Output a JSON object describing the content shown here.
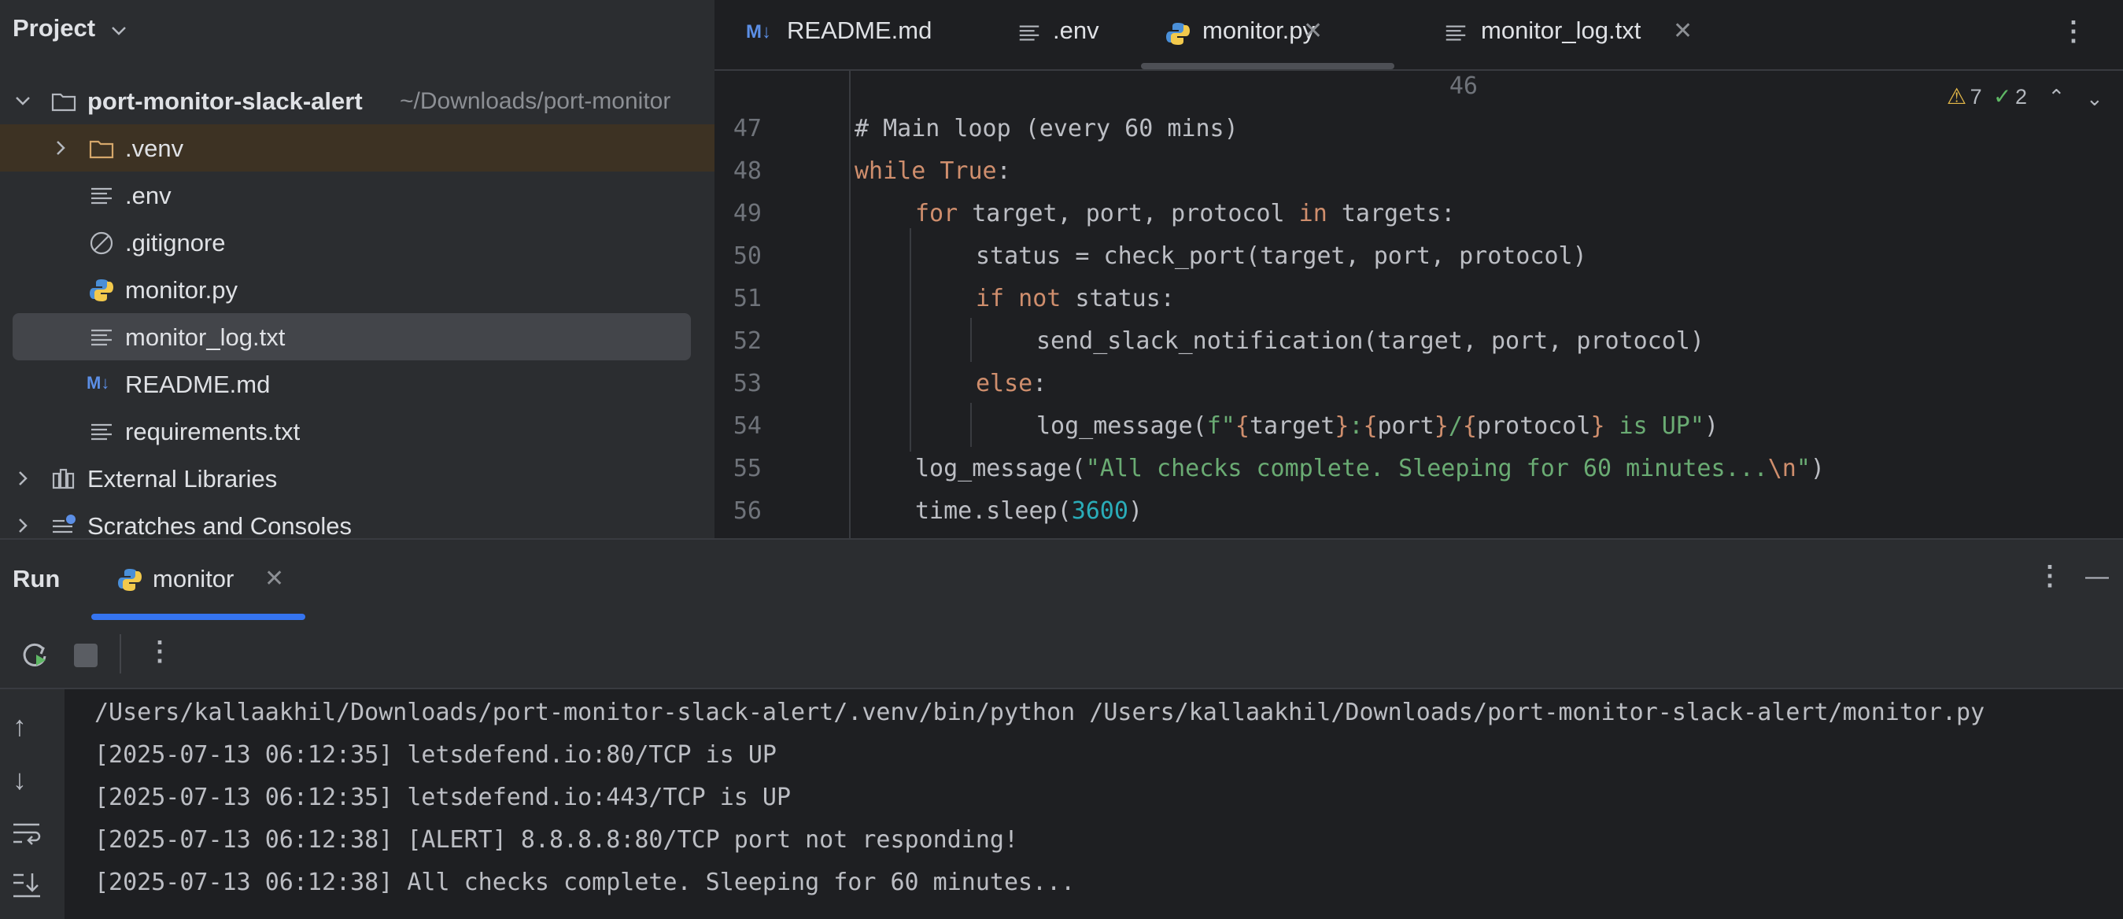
{
  "project": {
    "title": "Project",
    "tree": [
      {
        "label": "port-monitor-slack-alert",
        "path": "~/Downloads/port-monitor",
        "icon": "folder-icon"
      },
      {
        "label": ".venv",
        "icon": "folder-icon"
      },
      {
        "label": ".env",
        "icon": "text-file-icon"
      },
      {
        "label": ".gitignore",
        "icon": "ignore-file-icon"
      },
      {
        "label": "monitor.py",
        "icon": "python-icon"
      },
      {
        "label": "monitor_log.txt",
        "icon": "text-file-icon"
      },
      {
        "label": "README.md",
        "icon": "markdown-icon"
      },
      {
        "label": "requirements.txt",
        "icon": "text-file-icon"
      },
      {
        "label": "External Libraries",
        "icon": "library-icon"
      },
      {
        "label": "Scratches and Consoles",
        "icon": "scratches-icon"
      }
    ]
  },
  "editor": {
    "tabs": [
      {
        "label": "README.md",
        "icon": "markdown-icon"
      },
      {
        "label": ".env",
        "icon": "text-file-icon"
      },
      {
        "label": "monitor.py",
        "icon": "python-icon",
        "active": true
      },
      {
        "label": "monitor_log.txt",
        "icon": "text-file-icon"
      }
    ],
    "inspections": {
      "warnings": "7",
      "checks": "2"
    },
    "lines": [
      {
        "n": "46"
      },
      {
        "n": "47",
        "text": "# Main loop (every 60 mins)"
      },
      {
        "n": "48",
        "kw": "while",
        "rest_kw": "True",
        "rest": ":"
      },
      {
        "n": "49",
        "kw": "for",
        "a": "target, port, protocol",
        "kw2": "in",
        "b": "targets:"
      },
      {
        "n": "50",
        "text": "status = check_port(target, port, protocol)"
      },
      {
        "n": "51",
        "kw": "if not",
        "rest": "status:"
      },
      {
        "n": "52",
        "text": "send_slack_notification(target, port, protocol)"
      },
      {
        "n": "53",
        "kw": "else",
        "rest": ":"
      },
      {
        "n": "54",
        "a": "log_message(",
        "f": "f\"",
        "t1": "target",
        "s1": ":",
        "t2": "port",
        "s2": "/",
        "t3": "protocol",
        "s3": " is UP\"",
        "b": ")"
      },
      {
        "n": "55",
        "a": "log_message(",
        "s": "\"All checks complete. Sleeping for 60 minutes...",
        "esc": "\\n",
        "s2": "\"",
        "b": ")"
      },
      {
        "n": "56",
        "a": "time.sleep(",
        "num": "3600",
        "b": ")"
      }
    ]
  },
  "run": {
    "title": "Run",
    "tab_label": "monitor",
    "output": [
      "/Users/kallaakhil/Downloads/port-monitor-slack-alert/.venv/bin/python /Users/kallaakhil/Downloads/port-monitor-slack-alert/monitor.py",
      "[2025-07-13 06:12:35] letsdefend.io:80/TCP is UP",
      "[2025-07-13 06:12:35] letsdefend.io:443/TCP is UP",
      "[2025-07-13 06:12:38] [ALERT] 8.8.8.8:80/TCP port not responding!",
      "[2025-07-13 06:12:38] All checks complete. Sleeping for 60 minutes..."
    ]
  }
}
